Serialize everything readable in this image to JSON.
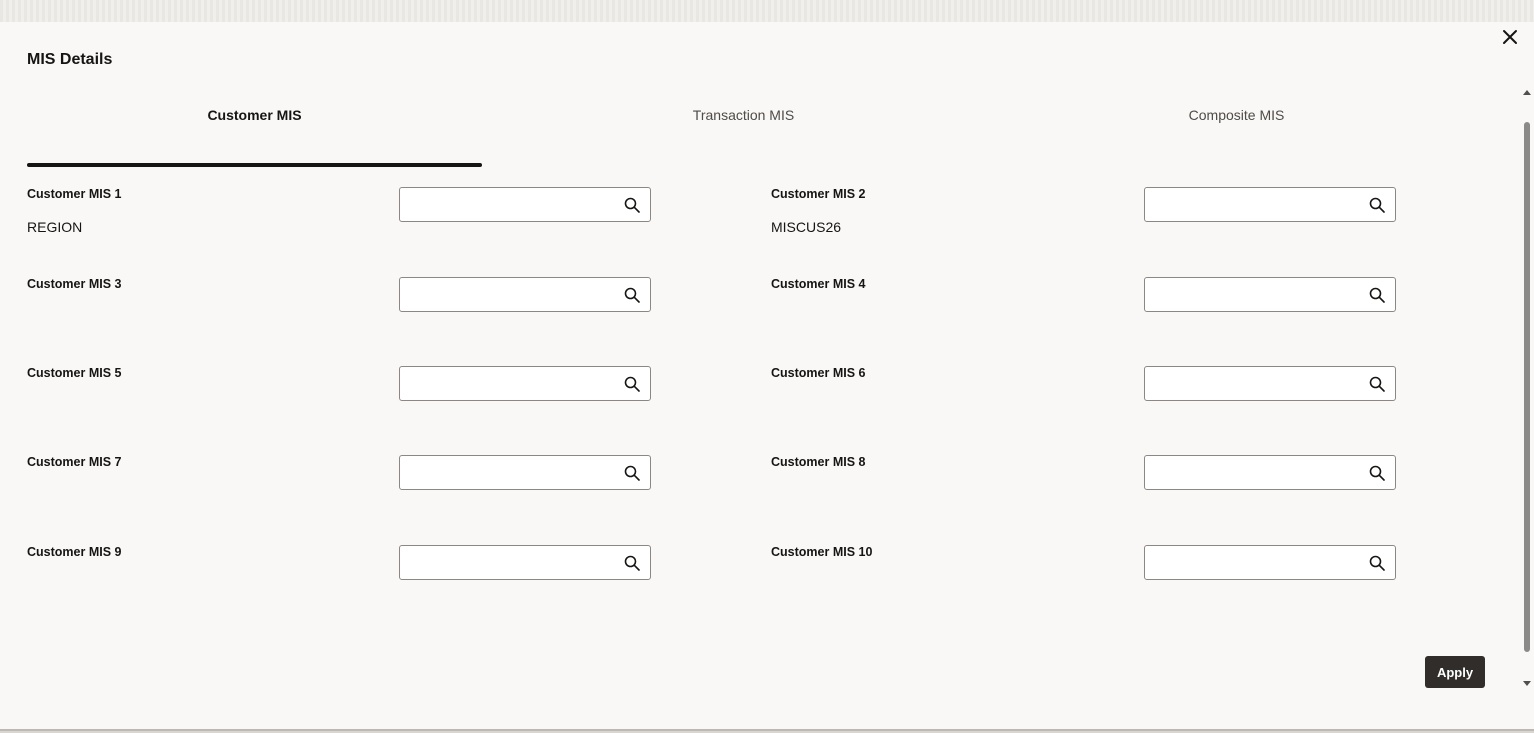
{
  "dialog": {
    "title": "MIS Details",
    "close_icon": "close-icon"
  },
  "tabs": [
    {
      "label": "Customer MIS",
      "active": true
    },
    {
      "label": "Transaction MIS",
      "active": false
    },
    {
      "label": "Composite MIS",
      "active": false
    }
  ],
  "fields": [
    {
      "label": "Customer MIS 1",
      "value": "REGION",
      "input": ""
    },
    {
      "label": "Customer MIS 2",
      "value": "MISCUS26",
      "input": ""
    },
    {
      "label": "Customer MIS 3",
      "value": "",
      "input": ""
    },
    {
      "label": "Customer MIS 4",
      "value": "",
      "input": ""
    },
    {
      "label": "Customer MIS 5",
      "value": "",
      "input": ""
    },
    {
      "label": "Customer MIS 6",
      "value": "",
      "input": ""
    },
    {
      "label": "Customer MIS 7",
      "value": "",
      "input": ""
    },
    {
      "label": "Customer MIS 8",
      "value": "",
      "input": ""
    },
    {
      "label": "Customer MIS 9",
      "value": "",
      "input": ""
    },
    {
      "label": "Customer MIS 10",
      "value": "",
      "input": ""
    }
  ],
  "footer": {
    "apply_label": "Apply"
  },
  "colors": {
    "dialog_bg": "#f9f8f6",
    "primary_button": "#312d2a",
    "tab_underline": "#161513"
  }
}
